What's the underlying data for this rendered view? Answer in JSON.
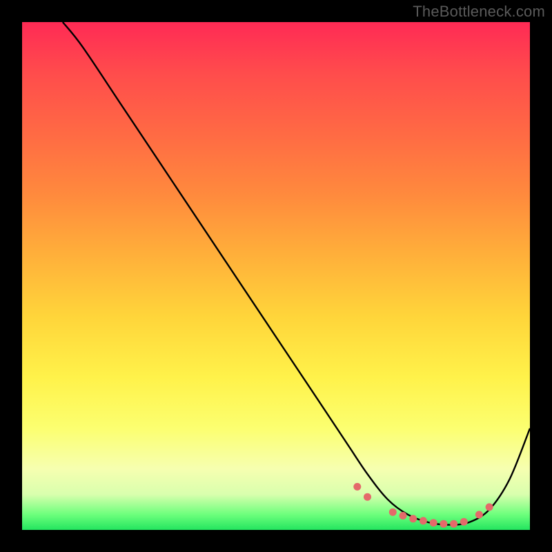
{
  "watermark": "TheBottleneck.com",
  "chart_data": {
    "type": "line",
    "title": "",
    "xlabel": "",
    "ylabel": "",
    "xlim": [
      0,
      100
    ],
    "ylim": [
      0,
      100
    ],
    "series": [
      {
        "name": "bottleneck-curve",
        "x": [
          8,
          12,
          20,
          30,
          40,
          50,
          58,
          64,
          68,
          72,
          76,
          80,
          84,
          88,
          92,
          96,
          100
        ],
        "y": [
          100,
          95,
          83,
          68,
          53,
          38,
          26,
          17,
          11,
          6,
          3,
          1.5,
          1,
          1.5,
          4,
          10,
          20
        ]
      }
    ],
    "flat_region_markers": {
      "name": "optimal-zone-dots",
      "color": "#e46a6a",
      "points": [
        {
          "x": 66,
          "y": 8.5
        },
        {
          "x": 68,
          "y": 6.5
        },
        {
          "x": 73,
          "y": 3.5
        },
        {
          "x": 75,
          "y": 2.8
        },
        {
          "x": 77,
          "y": 2.2
        },
        {
          "x": 79,
          "y": 1.8
        },
        {
          "x": 81,
          "y": 1.4
        },
        {
          "x": 83,
          "y": 1.2
        },
        {
          "x": 85,
          "y": 1.2
        },
        {
          "x": 87,
          "y": 1.6
        },
        {
          "x": 90,
          "y": 3.0
        },
        {
          "x": 92,
          "y": 4.5
        }
      ]
    },
    "gradient_stops": [
      {
        "pos": 0,
        "color": "#ff2a55"
      },
      {
        "pos": 70,
        "color": "#fff24a"
      },
      {
        "pos": 100,
        "color": "#23e55f"
      }
    ]
  }
}
